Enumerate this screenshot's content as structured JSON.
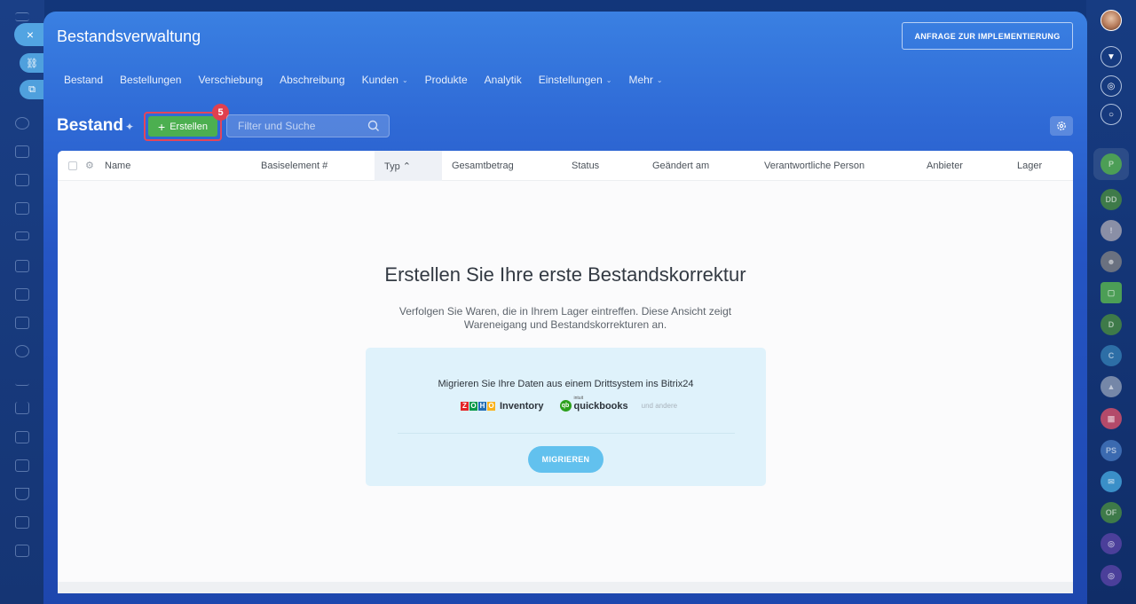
{
  "window": {
    "title": "Bestandsverwaltung",
    "impl_button": "ANFRAGE ZUR IMPLEMENTIERUNG",
    "close_glyph": "×"
  },
  "nav": {
    "items": [
      {
        "label": "Bestand",
        "dropdown": false
      },
      {
        "label": "Bestellungen",
        "dropdown": false
      },
      {
        "label": "Verschiebung",
        "dropdown": false
      },
      {
        "label": "Abschreibung",
        "dropdown": false
      },
      {
        "label": "Kunden",
        "dropdown": true
      },
      {
        "label": "Produkte",
        "dropdown": false
      },
      {
        "label": "Analytik",
        "dropdown": false
      },
      {
        "label": "Einstellungen",
        "dropdown": true
      },
      {
        "label": "Mehr",
        "dropdown": true
      }
    ]
  },
  "toolbar": {
    "page_title": "Bestand",
    "create_label": "Erstellen",
    "step_badge": "5",
    "search_placeholder": "Filter und Suche"
  },
  "table": {
    "columns": [
      "Name",
      "Basiselement #",
      "Typ ⌃",
      "Gesamtbetrag",
      "Status",
      "Geändert am",
      "Verantwortliche Person",
      "Anbieter",
      "Lager"
    ],
    "sorted_column": "Typ"
  },
  "empty_state": {
    "title": "Erstellen Sie Ihre erste Bestandskorrektur",
    "description": "Verfolgen Sie Waren, die in Ihrem Lager eintreffen. Diese Ansicht zeigt Wareneigang und Bestandskorrekturen an."
  },
  "migrate": {
    "title": "Migrieren Sie Ihre Daten aus einem Drittsystem ins Bitrix24",
    "zoho_letters": [
      "Z",
      "O",
      "H",
      "O"
    ],
    "inventory_label": "Inventory",
    "qb_sup": "intuit",
    "qb_label": "quickbooks",
    "others_label": "und andere",
    "button": "MIGRIEREN"
  },
  "right_rail": {
    "labels": [
      "P",
      "DD",
      "D",
      "C",
      "PS",
      "OF"
    ]
  },
  "colors": {
    "accent_green": "#4caf50",
    "badge_red": "#e0404f",
    "migrate_button": "#62c1ee",
    "panel_blue": "#2f6ad6"
  }
}
